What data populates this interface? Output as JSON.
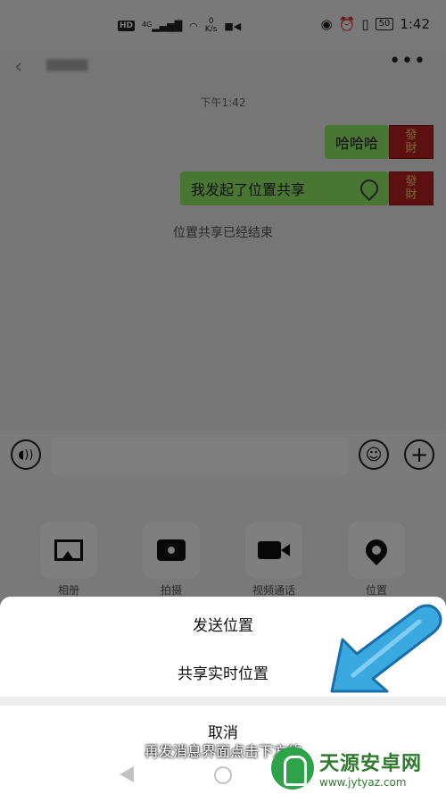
{
  "status_bar": {
    "hd": "HD",
    "network": "4G",
    "speed_value": "0",
    "speed_unit": "K/s",
    "battery": "50",
    "time": "1:42"
  },
  "chat": {
    "timestamp": "下午1:42",
    "messages": [
      {
        "text": "哈哈哈"
      },
      {
        "text": "我发起了位置共享"
      }
    ],
    "avatar_text": [
      "發",
      "財"
    ],
    "system_note": "位置共享已经结束"
  },
  "toolbar_panel": {
    "items": [
      {
        "label": "相册",
        "icon": "image-icon"
      },
      {
        "label": "拍摄",
        "icon": "camera-icon"
      },
      {
        "label": "视频通话",
        "icon": "video-icon"
      },
      {
        "label": "位置",
        "icon": "location-icon"
      }
    ]
  },
  "action_sheet": {
    "send_location": "发送位置",
    "share_live_location": "共享实时位置",
    "cancel": "取消"
  },
  "subtitle": "再发消息界面点击下方的",
  "watermark": {
    "title": "天源安卓网",
    "url": "www.jytyaz.com"
  },
  "colors": {
    "bubble": "#95ec69",
    "arrow": "#3aa9e0",
    "watermark": "#2f7a2f"
  }
}
